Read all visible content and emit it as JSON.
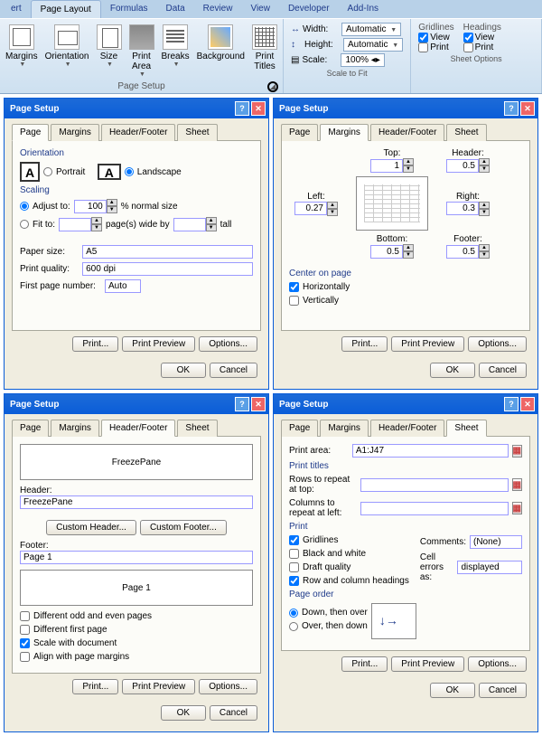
{
  "ribbon": {
    "tabs": [
      "ert",
      "Page Layout",
      "Formulas",
      "Data",
      "Review",
      "View",
      "Developer",
      "Add-Ins"
    ],
    "page_setup": {
      "label": "Page Setup",
      "margins": "Margins",
      "orientation": "Orientation",
      "size": "Size",
      "print_area": "Print\nArea",
      "breaks": "Breaks",
      "background": "Background",
      "print_titles": "Print\nTitles"
    },
    "scale": {
      "label": "Scale to Fit",
      "width": "Width:",
      "width_val": "Automatic",
      "height": "Height:",
      "height_val": "Automatic",
      "scale": "Scale:",
      "scale_val": "100%"
    },
    "sheet_opts": {
      "label": "Sheet Options",
      "gridlines": "Gridlines",
      "headings": "Headings",
      "view": "View",
      "print": "Print"
    }
  },
  "dialog_common": {
    "title": "Page Setup",
    "tabs": {
      "page": "Page",
      "margins": "Margins",
      "hf": "Header/Footer",
      "sheet": "Sheet"
    },
    "print": "Print...",
    "preview": "Print Preview",
    "options": "Options...",
    "ok": "OK",
    "cancel": "Cancel"
  },
  "page_tab": {
    "orientation": "Orientation",
    "portrait": "Portrait",
    "landscape": "Landscape",
    "scaling": "Scaling",
    "adjust": "Adjust to:",
    "adjust_val": "100",
    "normal": "% normal size",
    "fit": "Fit to:",
    "pages_wide": "page(s) wide by",
    "tall": "tall",
    "paper_size": "Paper size:",
    "paper_val": "A5",
    "quality": "Print quality:",
    "quality_val": "600 dpi",
    "first_page": "First page number:",
    "first_val": "Auto"
  },
  "margins_tab": {
    "top": "Top:",
    "top_v": "1",
    "header": "Header:",
    "header_v": "0.5",
    "left": "Left:",
    "left_v": "0.27",
    "right": "Right:",
    "right_v": "0.3",
    "bottom": "Bottom:",
    "bottom_v": "0.5",
    "footer": "Footer:",
    "footer_v": "0.5",
    "center": "Center on page",
    "horiz": "Horizontally",
    "vert": "Vertically"
  },
  "hf_tab": {
    "preview_top": "FreezePane",
    "header": "Header:",
    "header_val": "FreezePane",
    "custom_h": "Custom Header...",
    "custom_f": "Custom Footer...",
    "footer": "Footer:",
    "footer_val": "Page 1",
    "preview_bot": "Page 1",
    "diff_odd": "Different odd and even pages",
    "diff_first": "Different first page",
    "scale_doc": "Scale with document",
    "align_marg": "Align with page margins"
  },
  "sheet_tab": {
    "print_area": "Print area:",
    "pa_val": "A1:J47",
    "titles": "Print titles",
    "rows": "Rows to repeat at top:",
    "cols": "Columns to repeat at left:",
    "print": "Print",
    "gridlines": "Gridlines",
    "bw": "Black and white",
    "draft": "Draft quality",
    "rch": "Row and column headings",
    "comments": "Comments:",
    "comments_v": "(None)",
    "errors": "Cell errors as:",
    "errors_v": "displayed",
    "order": "Page order",
    "down_over": "Down, then over",
    "over_down": "Over, then down"
  }
}
